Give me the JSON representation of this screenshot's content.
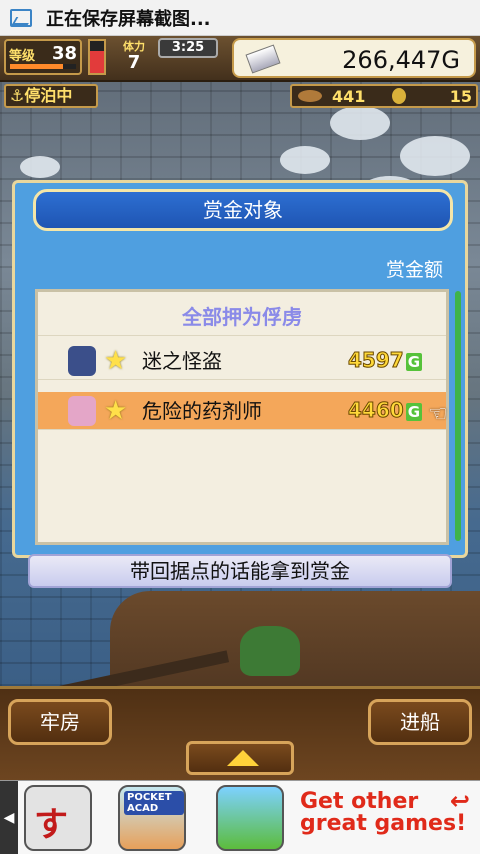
{
  "status_bar": {
    "text": "正在保存屏幕截图..."
  },
  "hud": {
    "level_label": "等级",
    "level": "38",
    "level_progress": 0.8,
    "health_fill": 0.7,
    "stamina_label": "体力",
    "stamina": "7",
    "clock": "3:25",
    "gold": "266,447G",
    "port_status": "停泊中",
    "resource_1": "441",
    "resource_2": "15"
  },
  "bounty_panel": {
    "title": "赏金对象",
    "column_header": "赏金额",
    "capture_all": "全部押为俘虏",
    "targets": [
      {
        "name": "迷之怪盗",
        "amount": "4597",
        "unit": "G"
      },
      {
        "name": "危险的药剂师",
        "amount": "4460",
        "unit": "G"
      }
    ],
    "hint": "带回据点的话能拿到赏金"
  },
  "bottom": {
    "jail_button": "牢房",
    "set_sail_button": "进船"
  },
  "ad": {
    "left_arrow": "◀",
    "app1_tag": "すし",
    "app2_tag": "POCKET ACAD",
    "line1": "Get other",
    "line2": "great games!"
  }
}
